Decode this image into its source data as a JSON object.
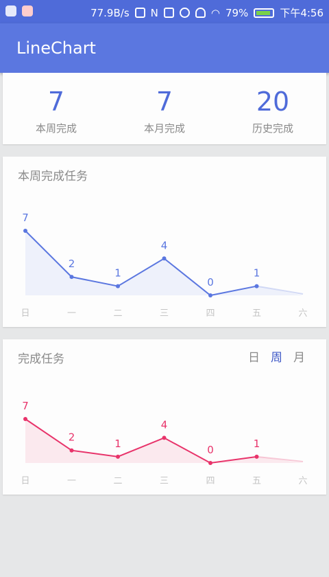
{
  "status_bar": {
    "net_speed": "77.9B/s",
    "battery_text": "79%",
    "time": "下午4:56",
    "icons": [
      "notification-icon",
      "app-icon",
      "sim-icon",
      "nfc-icon",
      "rotate-icon",
      "alarm-icon",
      "headset-icon",
      "wifi-icon",
      "battery-icon"
    ]
  },
  "app_bar": {
    "title": "LineChart",
    "color": "#5b77e0"
  },
  "summary": [
    {
      "value": "7",
      "label": "本周完成"
    },
    {
      "value": "7",
      "label": "本月完成"
    },
    {
      "value": "20",
      "label": "历史完成"
    }
  ],
  "week_card": {
    "title": "本周完成任务"
  },
  "tasks_card": {
    "title": "完成任务",
    "tabs": [
      "日",
      "周",
      "月"
    ],
    "active_tab": "周"
  },
  "chart_data": [
    {
      "type": "line",
      "categories": [
        "日",
        "一",
        "二",
        "三",
        "四",
        "五",
        "六"
      ],
      "values": [
        7,
        2,
        1,
        4,
        0,
        1,
        null
      ],
      "data_labels": [
        "7",
        "2",
        "1",
        "4",
        "0",
        "1",
        ""
      ],
      "color": "#5b77e0",
      "fill": "#eef1fb",
      "grid": false
    },
    {
      "type": "line",
      "categories": [
        "日",
        "一",
        "二",
        "三",
        "四",
        "五",
        "六"
      ],
      "values": [
        7,
        2,
        1,
        4,
        0,
        1,
        null
      ],
      "data_labels": [
        "7",
        "2",
        "1",
        "4",
        "0",
        "1",
        ""
      ],
      "color": "#e8336a",
      "fill": "#fbe9ee",
      "grid": false
    }
  ]
}
